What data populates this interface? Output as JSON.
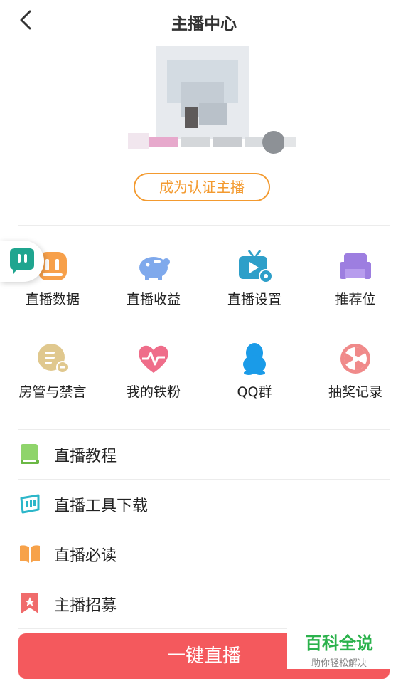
{
  "header": {
    "title": "主播中心"
  },
  "profile": {
    "certify_label": "成为认证主播"
  },
  "grid": [
    {
      "label": "直播数据",
      "icon": "data-chart-icon"
    },
    {
      "label": "直播收益",
      "icon": "piggy-bank-icon"
    },
    {
      "label": "直播设置",
      "icon": "tv-settings-icon"
    },
    {
      "label": "推荐位",
      "icon": "sofa-icon"
    },
    {
      "label": "房管与禁言",
      "icon": "chat-mute-icon"
    },
    {
      "label": "我的铁粉",
      "icon": "heart-pulse-icon"
    },
    {
      "label": "QQ群",
      "icon": "qq-penguin-icon"
    },
    {
      "label": "抽奖记录",
      "icon": "lottery-wheel-icon"
    }
  ],
  "list": [
    {
      "label": "直播教程",
      "icon": "book-icon"
    },
    {
      "label": "直播工具下载",
      "icon": "tool-download-icon"
    },
    {
      "label": "直播必读",
      "icon": "open-book-icon"
    },
    {
      "label": "主播招募",
      "icon": "bookmark-star-icon"
    }
  ],
  "live_button": {
    "label": "一键直播"
  },
  "watermark": {
    "title": "百科全说",
    "subtitle": "助你轻松解决"
  },
  "colors": {
    "accent_orange": "#f39a2f",
    "live_red": "#f4595d",
    "watermark_green": "#2bb24c"
  }
}
